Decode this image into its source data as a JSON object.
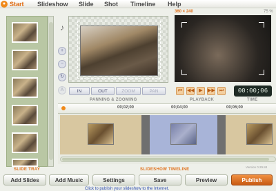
{
  "menu": {
    "items": [
      "Start",
      "Slideshow",
      "Slide",
      "Shot",
      "Timeline",
      "Help"
    ]
  },
  "tray": {
    "label": "SLIDE TRAY",
    "slide_count": 7
  },
  "preview": {
    "panning_label": "PANNING & ZOOMING",
    "buttons": {
      "in": "IN",
      "out": "OUT",
      "zoom": "ZOOM",
      "pan": "PAN"
    }
  },
  "playback": {
    "resolution": "360 × 240",
    "zoom_pct": "75 %",
    "label": "PLAYBACK",
    "time_label": "TIME",
    "time": "00:00;06"
  },
  "timeline": {
    "label": "SLIDESHOW TIMELINE",
    "ticks": [
      "00;02;00",
      "00;04;00",
      "00;06;00"
    ]
  },
  "actions": {
    "add_slides": "Add Slides",
    "add_music": "Add Music",
    "settings": "Settings",
    "save": "Save",
    "preview": "Preview",
    "publish": "Publish"
  },
  "footer": {
    "hint": "Click to publish your slideshow to the Internet.",
    "version": "Version 0.29.84"
  },
  "colors": {
    "accent": "#e0701a",
    "tray_bg": "#b9c7a4",
    "timer_bg": "#1e2a24"
  }
}
